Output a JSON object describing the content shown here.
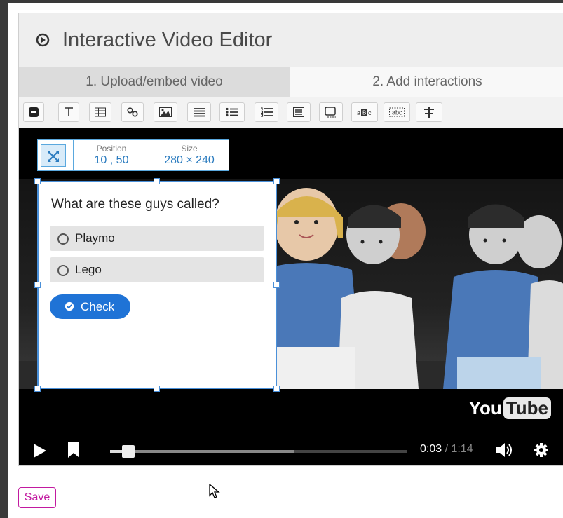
{
  "header": {
    "title": "Interactive Video Editor",
    "icon": "play-circle-icon"
  },
  "tabs": [
    {
      "label": "1. Upload/embed video",
      "active": true
    },
    {
      "label": "2. Add interactions",
      "active": false
    }
  ],
  "toolbar": {
    "tools": [
      "statement-icon",
      "text-icon",
      "table-icon",
      "link-icon",
      "image-icon",
      "summary-icon",
      "single-choice-icon",
      "multiple-choice-icon",
      "true-false-icon",
      "fill-blanks-icon",
      "drag-text-icon",
      "mark-words-icon",
      "navigation-hotspot-icon"
    ]
  },
  "interaction_box": {
    "position_label": "Position",
    "position_value": "10 , 50",
    "size_label": "Size",
    "size_value": "280 × 240"
  },
  "question": {
    "text": "What are these guys called?",
    "options": [
      "Playmo",
      "Lego"
    ],
    "check_label": "Check"
  },
  "video": {
    "logo_you": "You",
    "logo_tube": "Tube",
    "current_time": "0:03",
    "separator": " / ",
    "duration": "1:14",
    "progress": 0.04,
    "buffered": 0.62
  },
  "footer": {
    "save_label": "Save"
  },
  "colors": {
    "accent": "#1f73d6",
    "save": "#c21aa0",
    "selection": "#4a90d9"
  }
}
